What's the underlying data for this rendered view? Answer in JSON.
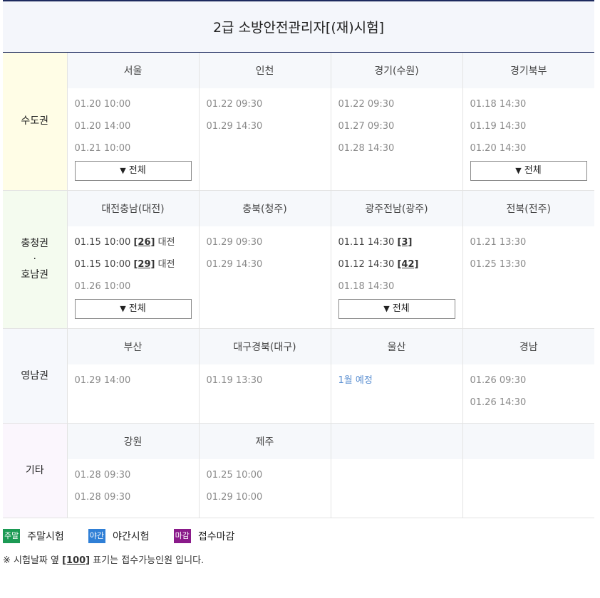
{
  "title": "2급 소방안전관리자[(재)시험]",
  "regions": [
    {
      "name": "수도권",
      "cities": [
        {
          "name": "서울",
          "dates": [
            "01.20 10:00",
            "01.20 14:00",
            "01.21 10:00"
          ],
          "more": "전체"
        },
        {
          "name": "인천",
          "dates": [
            "01.22 09:30",
            "01.29 14:30"
          ]
        },
        {
          "name": "경기(수원)",
          "dates": [
            "01.22 09:30",
            "01.27 09:30",
            "01.28 14:30"
          ]
        },
        {
          "name": "경기북부",
          "dates": [
            "01.18 14:30",
            "01.19 14:30",
            "01.20 14:30"
          ],
          "more": "전체"
        }
      ]
    },
    {
      "name_line1": "충청권",
      "name_dot": "·",
      "name_line2": "호남권",
      "cities": [
        {
          "name": "대전충남(대전)",
          "dates": [
            {
              "time": "01.15 10:00",
              "cap": "[26]",
              "place": "대전"
            },
            {
              "time": "01.15 10:00",
              "cap": "[29]",
              "place": "대전"
            },
            {
              "time": "01.26 10:00"
            }
          ],
          "more": "전체"
        },
        {
          "name": "충북(청주)",
          "dates": [
            "01.29 09:30",
            "01.29 14:30"
          ]
        },
        {
          "name": "광주전남(광주)",
          "dates": [
            {
              "time": "01.11 14:30",
              "cap": "[3]"
            },
            {
              "time": "01.12 14:30",
              "cap": "[42]"
            },
            {
              "time": "01.18 14:30"
            }
          ],
          "more": "전체"
        },
        {
          "name": "전북(전주)",
          "dates": [
            "01.21 13:30",
            "01.25 13:30"
          ]
        }
      ]
    },
    {
      "name": "영남권",
      "cities": [
        {
          "name": "부산",
          "dates": [
            "01.29 14:00"
          ]
        },
        {
          "name": "대구경북(대구)",
          "dates": [
            "01.19 13:30"
          ]
        },
        {
          "name": "울산",
          "plan": "1월 예정"
        },
        {
          "name": "경남",
          "dates": [
            "01.26 09:30",
            "01.26 14:30"
          ]
        }
      ]
    },
    {
      "name": "기타",
      "cities": [
        {
          "name": "강원",
          "dates": [
            "01.28 09:30",
            "01.28 09:30"
          ]
        },
        {
          "name": "제주",
          "dates": [
            "01.25 10:00",
            "01.29 10:00"
          ]
        }
      ]
    }
  ],
  "more_arrow": "▼",
  "legend": [
    {
      "badge": "주말",
      "label": "주말시험",
      "color": "#1c9a54"
    },
    {
      "badge": "야간",
      "label": "야간시험",
      "color": "#2f7fd6"
    },
    {
      "badge": "마감",
      "label": "접수마감",
      "color": "#8a1a8a"
    }
  ],
  "note": {
    "prefix": "※ 시험날짜 옆 ",
    "example": "[100]",
    "suffix": " 표기는 접수가능인원 입니다."
  }
}
